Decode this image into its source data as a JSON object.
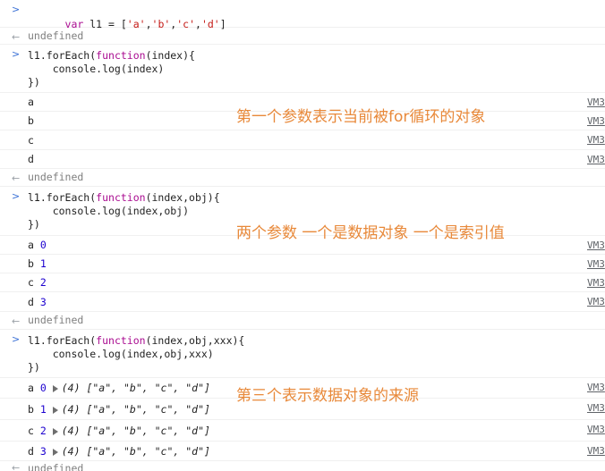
{
  "console": {
    "cmd1": "var l1 = ['a','b','c','d']",
    "undef": "undefined",
    "cmd2": {
      "l1": "l1.forEach(",
      "kw": "function",
      "args": "(index){",
      "l2": "    console.log(index)",
      "l3": "})"
    },
    "out1": [
      "a",
      "b",
      "c",
      "d"
    ],
    "cmd3": {
      "l1": "l1.forEach(",
      "kw": "function",
      "args": "(index,obj){",
      "l2": "    console.log(index,obj)",
      "l3": "})"
    },
    "out2": [
      {
        "v": "a",
        "n": "0"
      },
      {
        "v": "b",
        "n": "1"
      },
      {
        "v": "c",
        "n": "2"
      },
      {
        "v": "d",
        "n": "3"
      }
    ],
    "cmd4": {
      "l1": "l1.forEach(",
      "kw": "function",
      "args": "(index,obj,xxx){",
      "l2": "    console.log(index,obj,xxx)",
      "l3": "})"
    },
    "out3": [
      {
        "v": "a",
        "n": "0",
        "arr": "(4) [\"a\", \"b\", \"c\", \"d\"]"
      },
      {
        "v": "b",
        "n": "1",
        "arr": "(4) [\"a\", \"b\", \"c\", \"d\"]"
      },
      {
        "v": "c",
        "n": "2",
        "arr": "(4) [\"a\", \"b\", \"c\", \"d\"]"
      },
      {
        "v": "d",
        "n": "3",
        "arr": "(4) [\"a\", \"b\", \"c\", \"d\"]"
      }
    ],
    "src": "VM3",
    "last": "undefined"
  },
  "notes": {
    "n1": "第一个参数表示当前被for循环的对象",
    "n2": "两个参数 一个是数据对象 一个是索引值",
    "n3": "第三个表示数据对象的来源"
  },
  "colors": {
    "note": "#e8893a",
    "keyword": "#aa0d91",
    "number": "#1c00cf"
  }
}
